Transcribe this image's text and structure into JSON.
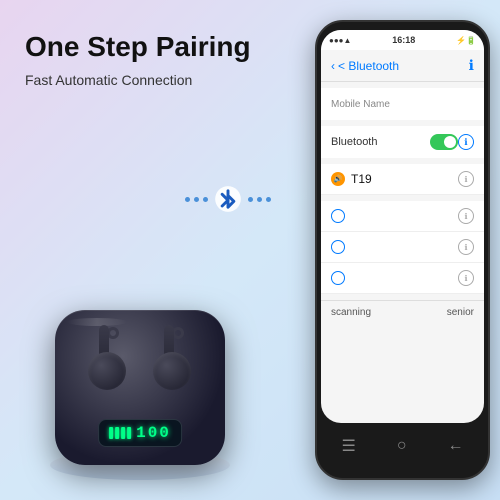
{
  "heading": "One Step Pairing",
  "subheading": "Fast Automatic Connection",
  "bluetooth_symbol": "ʙ",
  "phone": {
    "status_time": "16:18",
    "status_signal": "●●●",
    "nav_back": "< Bluetooth",
    "nav_icon": "ℹ",
    "section1": {
      "row1_label": "Mobile Name",
      "row1_value": ""
    },
    "section2": {
      "row1_label": "Bluetooth",
      "toggle": "on"
    },
    "device_t19": {
      "name": "T19",
      "dot_color": "#FF9500"
    },
    "other_devices": [
      {
        "label": ""
      },
      {
        "label": ""
      },
      {
        "label": ""
      }
    ],
    "scanning_label": "scanning",
    "senior_label": "senior",
    "bottom_icons": [
      "☰",
      "○",
      "←"
    ]
  },
  "earbuds": {
    "battery_display": "100",
    "bars": 4
  }
}
